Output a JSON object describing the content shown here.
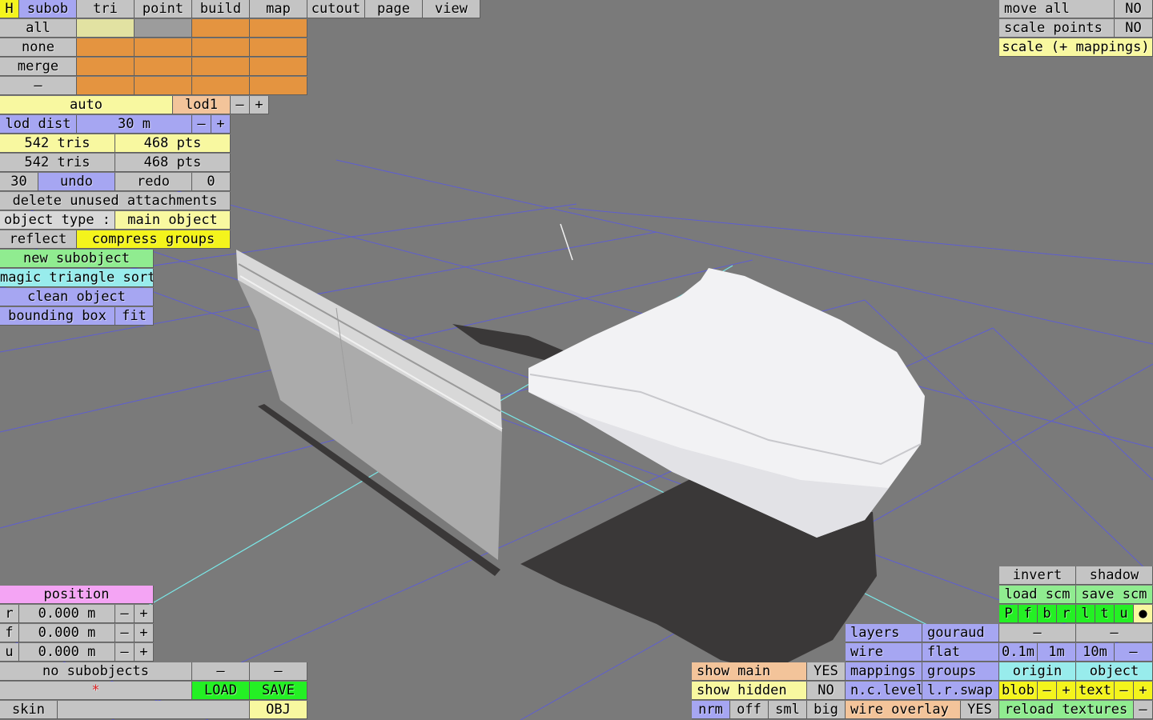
{
  "top_tabs": {
    "h": "H",
    "subob": "subob",
    "tri": "tri",
    "point": "point",
    "build": "build",
    "map": "map",
    "cutout": "cutout",
    "page": "page",
    "view": "view"
  },
  "selection": {
    "all": "all",
    "none": "none",
    "merge": "merge",
    "dash": "–"
  },
  "lod": {
    "auto": "auto",
    "level": "lod1",
    "minus": "–",
    "plus": "+",
    "dist_label": "lod dist",
    "dist_value": "30 m"
  },
  "stats": {
    "tris1": "542 tris",
    "pts1": "468 pts",
    "tris2": "542 tris",
    "pts2": "468 pts"
  },
  "history": {
    "undo_count": "30",
    "undo": "undo",
    "redo": "redo",
    "redo_count": "0"
  },
  "actions": {
    "delete_unused": "delete unused attachments",
    "object_type_label": "object type :",
    "object_type_value": "main object",
    "reflect": "reflect",
    "compress_groups": "compress groups",
    "new_subobject": "new subobject",
    "magic_sort": "magic triangle sort",
    "clean_object": "clean object",
    "bounding_box": "bounding box",
    "fit": "fit"
  },
  "transform": {
    "move_all": "move all",
    "move_all_value": "NO",
    "scale_points": "scale points",
    "scale_points_value": "NO",
    "scale_mappings": "scale (+ mappings)"
  },
  "position": {
    "title": "position",
    "r_label": "r",
    "r_value": "0.000 m",
    "f_label": "f",
    "f_value": "0.000 m",
    "u_label": "u",
    "u_value": "0.000 m",
    "minus": "–",
    "plus": "+"
  },
  "subobjects": {
    "no_subobjects": "no subobjects",
    "dash": "–",
    "star": "*",
    "load": "LOAD",
    "save": "SAVE",
    "skin": "skin",
    "obj": "OBJ"
  },
  "display": {
    "show_main": "show main",
    "show_main_value": "YES",
    "show_hidden": "show hidden",
    "show_hidden_value": "NO",
    "nrm": "nrm",
    "off": "off",
    "sml": "sml",
    "big": "big",
    "layers": "layers",
    "gouraud": "gouraud",
    "wire": "wire",
    "flat": "flat",
    "mappings": "mappings",
    "groups": "groups",
    "nc_level": "n.c.level",
    "lr_swap": "l.r.swap",
    "wire_overlay": "wire overlay",
    "wire_overlay_value": "YES"
  },
  "view_panel": {
    "invert": "invert",
    "shadow": "shadow",
    "load_scm": "load scm",
    "save_scm": "save scm",
    "p": "P",
    "f": "f",
    "b": "b",
    "r": "r",
    "l": "l",
    "t": "t",
    "u": "u",
    "dot": "●",
    "dash": "–",
    "m01": "0.1m",
    "m1": "1m",
    "m10": "10m",
    "origin": "origin",
    "object": "object",
    "blob": "blob",
    "text": "text",
    "minus": "–",
    "plus": "+",
    "reload_textures": "reload textures"
  },
  "colors": {
    "background": "#7a7a7a",
    "grid": "#5a5ae0",
    "axis": "#7ae8e8",
    "panel_blue": "#a6a6f2",
    "panel_yellow": "#f8f8a0",
    "panel_orange": "#e49440",
    "panel_green": "#90ec90"
  }
}
